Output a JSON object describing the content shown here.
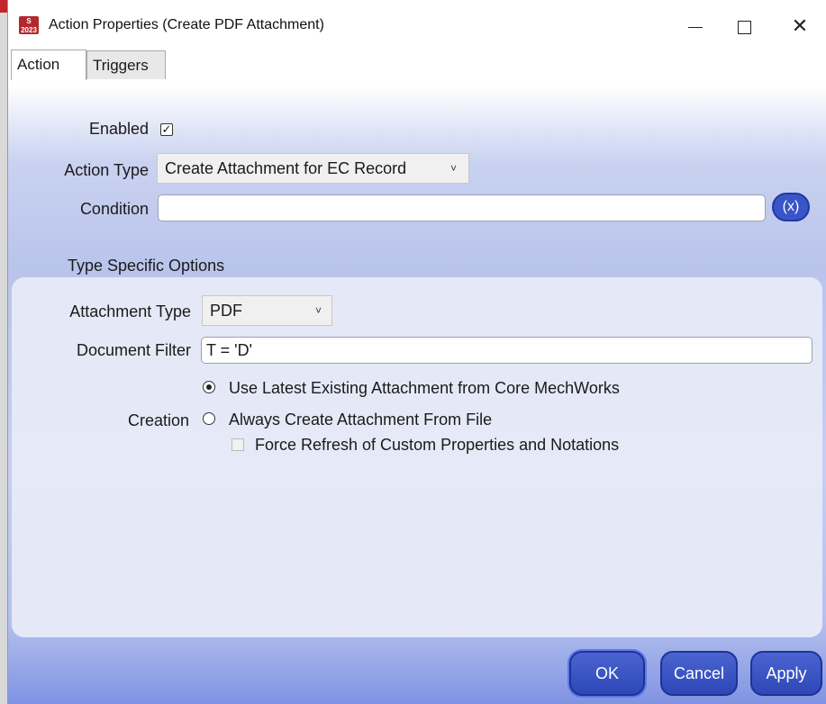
{
  "window": {
    "title": "Action Properties (Create PDF Attachment)",
    "icon": "app-icon",
    "icon_text_top": "S",
    "icon_text_bottom": "2023"
  },
  "tabs": [
    {
      "label": "Action",
      "active": true
    },
    {
      "label": "Triggers",
      "active": false
    }
  ],
  "general": {
    "enabled_label": "Enabled",
    "enabled_checked": true,
    "action_type_label": "Action Type",
    "action_type_value": "Create Attachment for EC Record",
    "condition_label": "Condition",
    "condition_value": "",
    "condition_button": "(x)"
  },
  "type_specific": {
    "section_title": "Type Specific Options",
    "attachment_type_label": "Attachment Type",
    "attachment_type_value": "PDF",
    "document_filter_label": "Document Filter",
    "document_filter_value": "T = 'D'",
    "creation_label": "Creation",
    "creation_options": [
      {
        "label": "Use Latest Existing Attachment from Core MechWorks",
        "selected": true
      },
      {
        "label": "Always Create Attachment From File",
        "selected": false
      }
    ],
    "force_refresh_label": "Force Refresh of Custom Properties and Notations",
    "force_refresh_checked": false,
    "force_refresh_enabled": false
  },
  "buttons": {
    "ok": "OK",
    "cancel": "Cancel",
    "apply": "Apply"
  },
  "colors": {
    "accent": "#2e47b8"
  }
}
